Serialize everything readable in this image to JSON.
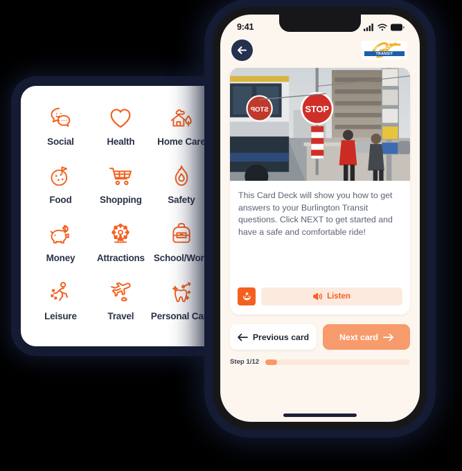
{
  "categories": [
    {
      "label": "Social",
      "icon": "speech-bubbles-icon"
    },
    {
      "label": "Health",
      "icon": "heart-icon"
    },
    {
      "label": "Home Care",
      "icon": "house-tree-icon"
    },
    {
      "label": "Food",
      "icon": "pizza-icon"
    },
    {
      "label": "Shopping",
      "icon": "shopping-cart-icon"
    },
    {
      "label": "Safety",
      "icon": "flame-icon"
    },
    {
      "label": "Money",
      "icon": "piggy-bank-icon"
    },
    {
      "label": "Attractions",
      "icon": "ferris-wheel-icon"
    },
    {
      "label": "School/Work",
      "icon": "backpack-icon"
    },
    {
      "label": "Leisure",
      "icon": "running-person-icon"
    },
    {
      "label": "Travel",
      "icon": "airplane-icon"
    },
    {
      "label": "Personal Care",
      "icon": "tooth-brush-icon"
    }
  ],
  "phone": {
    "status": {
      "time": "9:41",
      "cellular_icon": "signal-bars-icon",
      "wifi_icon": "wifi-icon",
      "battery_icon": "battery-icon"
    },
    "header": {
      "back_icon": "arrow-left-icon",
      "logo_text": "BURLINGTON TRANSIT",
      "logo_name": "burlington-transit-logo"
    },
    "card": {
      "image_alt": "bus-at-stop-photo",
      "body": "This Card Deck will show you how to get answers to your Burlington Transit questions. Click NEXT to get started and have a safe and comfortable ride!",
      "accessibility_icon": "accessibility-face-icon",
      "listen_label": "Listen",
      "listen_icon": "speaker-icon"
    },
    "nav": {
      "previous_label": "Previous card",
      "previous_icon": "arrow-left-icon",
      "next_label": "Next card",
      "next_icon": "arrow-right-icon"
    },
    "progress": {
      "step_label": "Step 1/12",
      "percent": 8
    }
  },
  "colors": {
    "orange": "#F4601F",
    "salmon": "#F89B6C",
    "peach_bg": "#FDEADE",
    "dark_navy": "#24314F",
    "text_dark": "#2B3246",
    "screen_bg": "#FDF6EF"
  }
}
